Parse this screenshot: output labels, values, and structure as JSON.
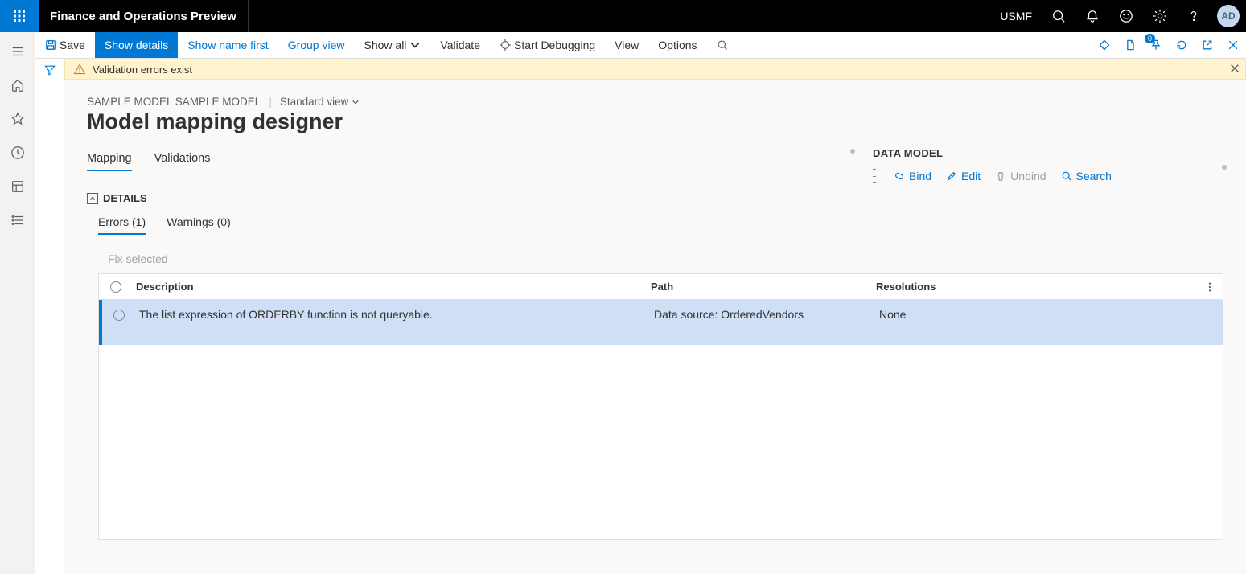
{
  "titlebar": {
    "app_title": "Finance and Operations Preview",
    "company": "USMF",
    "avatar_initials": "AD"
  },
  "actionbar": {
    "save": "Save",
    "show_details": "Show details",
    "show_name_first": "Show name first",
    "group_view": "Group view",
    "show_all": "Show all",
    "validate": "Validate",
    "start_debugging": "Start Debugging",
    "view": "View",
    "options": "Options"
  },
  "warning": {
    "text": "Validation errors exist"
  },
  "page": {
    "crumb_model": "SAMPLE MODEL SAMPLE MODEL",
    "view_name": "Standard view",
    "title": "Model mapping designer"
  },
  "tabs": {
    "mapping": "Mapping",
    "validations": "Validations"
  },
  "datamodel": {
    "heading": "DATA MODEL",
    "bind": "Bind",
    "edit": "Edit",
    "unbind": "Unbind",
    "search": "Search"
  },
  "details": {
    "heading": "DETAILS",
    "errors_tab": "Errors (1)",
    "warnings_tab": "Warnings (0)",
    "fix_selected": "Fix selected",
    "columns": {
      "description": "Description",
      "path": "Path",
      "resolutions": "Resolutions"
    },
    "rows": [
      {
        "description": "The list expression of ORDERBY function is not queryable.",
        "path": "Data source: OrderedVendors",
        "resolutions": "None"
      }
    ]
  },
  "right_toolbar_badge": "0"
}
